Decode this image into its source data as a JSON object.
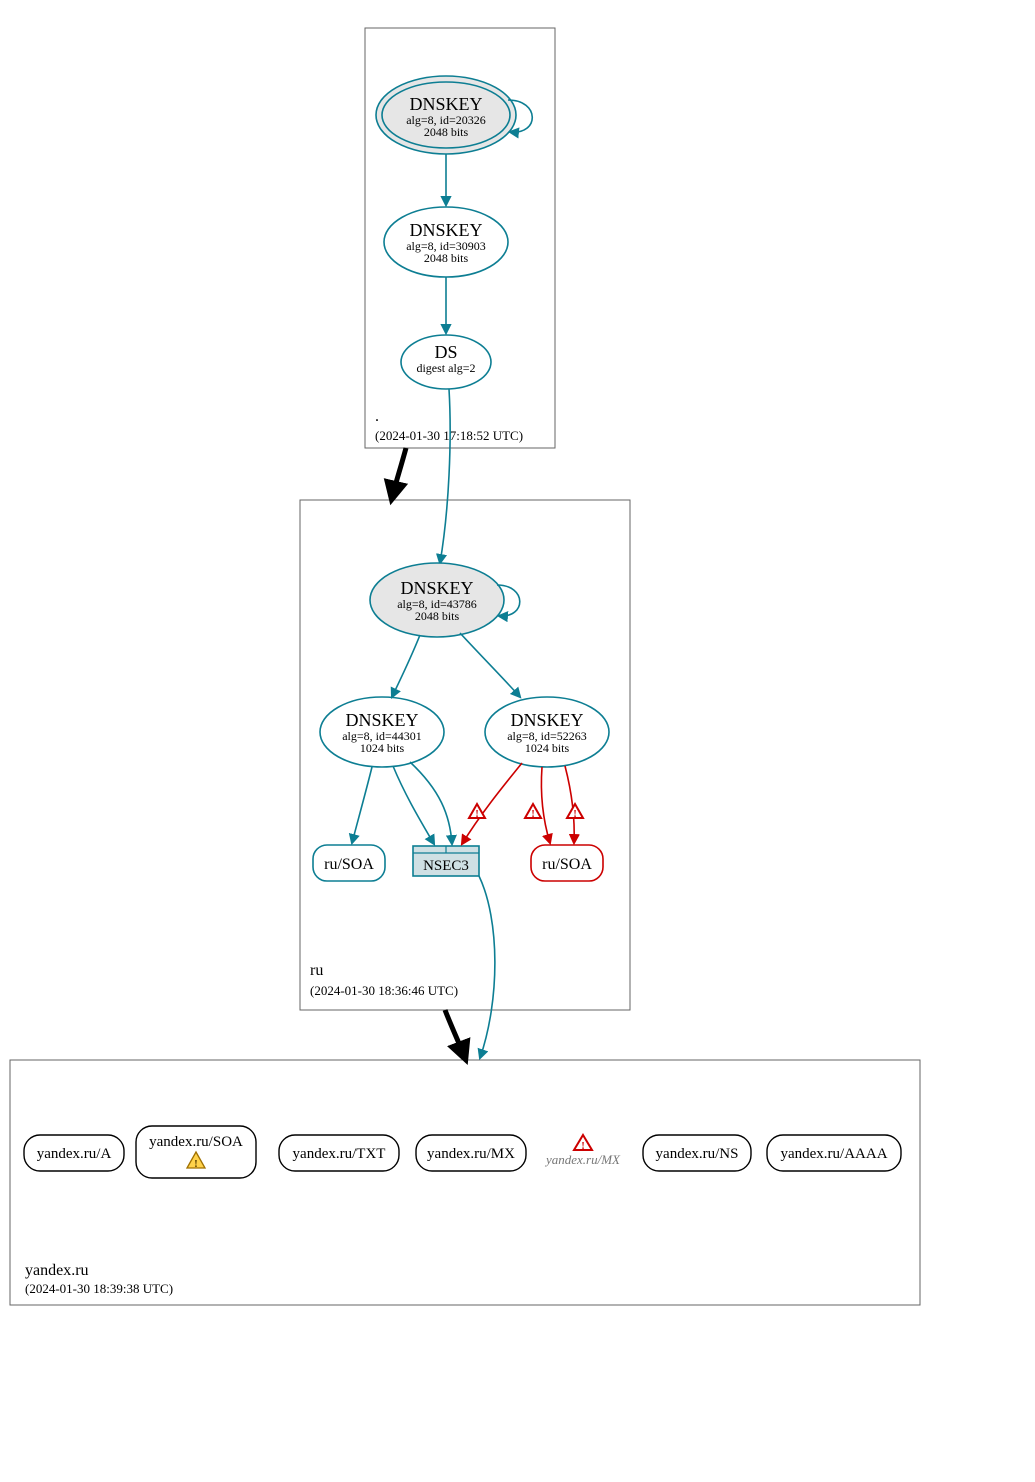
{
  "colors": {
    "teal": "#0d7e93",
    "red": "#c00",
    "yellow": "#e6b400",
    "nodeFill": "#e6e6e6"
  },
  "zones": {
    "root": {
      "name": ".",
      "time": "(2024-01-30 17:18:52 UTC)"
    },
    "ru": {
      "name": "ru",
      "time": "(2024-01-30 18:36:46 UTC)"
    },
    "yandex": {
      "name": "yandex.ru",
      "time": "(2024-01-30 18:39:38 UTC)"
    }
  },
  "nodes": {
    "root_ksk": {
      "title": "DNSKEY",
      "line2": "alg=8, id=20326",
      "line3": "2048 bits"
    },
    "root_zsk": {
      "title": "DNSKEY",
      "line2": "alg=8, id=30903",
      "line3": "2048 bits"
    },
    "root_ds": {
      "title": "DS",
      "line2": "digest alg=2"
    },
    "ru_ksk": {
      "title": "DNSKEY",
      "line2": "alg=8, id=43786",
      "line3": "2048 bits"
    },
    "ru_zsk_a": {
      "title": "DNSKEY",
      "line2": "alg=8, id=44301",
      "line3": "1024 bits"
    },
    "ru_zsk_b": {
      "title": "DNSKEY",
      "line2": "alg=8, id=52263",
      "line3": "1024 bits"
    },
    "ru_soa_ok": {
      "label": "ru/SOA"
    },
    "ru_soa_bad": {
      "label": "ru/SOA"
    },
    "nsec3": {
      "label": "NSEC3"
    }
  },
  "leaf": {
    "a": "yandex.ru/A",
    "soa": "yandex.ru/SOA",
    "txt": "yandex.ru/TXT",
    "mx": "yandex.ru/MX",
    "mx2": "yandex.ru/MX",
    "ns": "yandex.ru/NS",
    "aaaa": "yandex.ru/AAAA"
  }
}
